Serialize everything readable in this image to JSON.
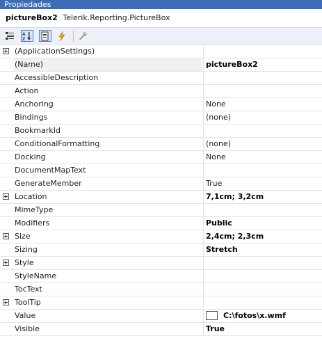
{
  "window": {
    "title": "Propiedades"
  },
  "object_selector": {
    "name": "pictureBox2",
    "type": "Telerik.Reporting.PictureBox"
  },
  "toolbar": {
    "buttons": [
      {
        "id": "categorized",
        "icon": "categorized-icon",
        "active": false
      },
      {
        "id": "alphabetical",
        "icon": "alphabetical-sort-icon",
        "active": true
      },
      {
        "id": "properties",
        "icon": "properties-page-icon",
        "active": true
      },
      {
        "id": "events",
        "icon": "lightning-events-icon",
        "active": false
      },
      {
        "id": "property_pages",
        "icon": "wrench-icon",
        "active": false
      }
    ]
  },
  "properties": [
    {
      "name": "(ApplicationSettings)",
      "value": "",
      "expandable": true,
      "bold": false
    },
    {
      "name": "(Name)",
      "value": "pictureBox2",
      "expandable": false,
      "bold": true,
      "selected": true
    },
    {
      "name": "AccessibleDescription",
      "value": "",
      "expandable": false,
      "bold": false
    },
    {
      "name": "Action",
      "value": "",
      "expandable": false,
      "bold": false
    },
    {
      "name": "Anchoring",
      "value": "None",
      "expandable": false,
      "bold": false
    },
    {
      "name": "Bindings",
      "value": "(none)",
      "expandable": false,
      "bold": false
    },
    {
      "name": "BookmarkId",
      "value": "",
      "expandable": false,
      "bold": false
    },
    {
      "name": "ConditionalFormatting",
      "value": "(none)",
      "expandable": false,
      "bold": false
    },
    {
      "name": "Docking",
      "value": "None",
      "expandable": false,
      "bold": false
    },
    {
      "name": "DocumentMapText",
      "value": "",
      "expandable": false,
      "bold": false
    },
    {
      "name": "GenerateMember",
      "value": "True",
      "expandable": false,
      "bold": false
    },
    {
      "name": "Location",
      "value": "7,1cm; 3,2cm",
      "expandable": true,
      "bold": true
    },
    {
      "name": "MimeType",
      "value": "",
      "expandable": false,
      "bold": false
    },
    {
      "name": "Modifiers",
      "value": "Public",
      "expandable": false,
      "bold": true
    },
    {
      "name": "Size",
      "value": "2,4cm; 2,3cm",
      "expandable": true,
      "bold": true
    },
    {
      "name": "Sizing",
      "value": "Stretch",
      "expandable": false,
      "bold": true
    },
    {
      "name": "Style",
      "value": "",
      "expandable": true,
      "bold": false
    },
    {
      "name": "StyleName",
      "value": "",
      "expandable": false,
      "bold": false
    },
    {
      "name": "TocText",
      "value": "",
      "expandable": false,
      "bold": false
    },
    {
      "name": "ToolTip",
      "value": "",
      "expandable": true,
      "bold": false
    },
    {
      "name": "Value",
      "value": "C:\\fotos\\x.wmf",
      "expandable": false,
      "bold": true,
      "swatch": true
    },
    {
      "name": "Visible",
      "value": "True",
      "expandable": false,
      "bold": true
    }
  ],
  "colors": {
    "title_bar": "#3c6db4",
    "toolbar_bg": "#eef0f8",
    "grid_line": "#e4e4e4",
    "selected_row": "#f0f0f0"
  }
}
